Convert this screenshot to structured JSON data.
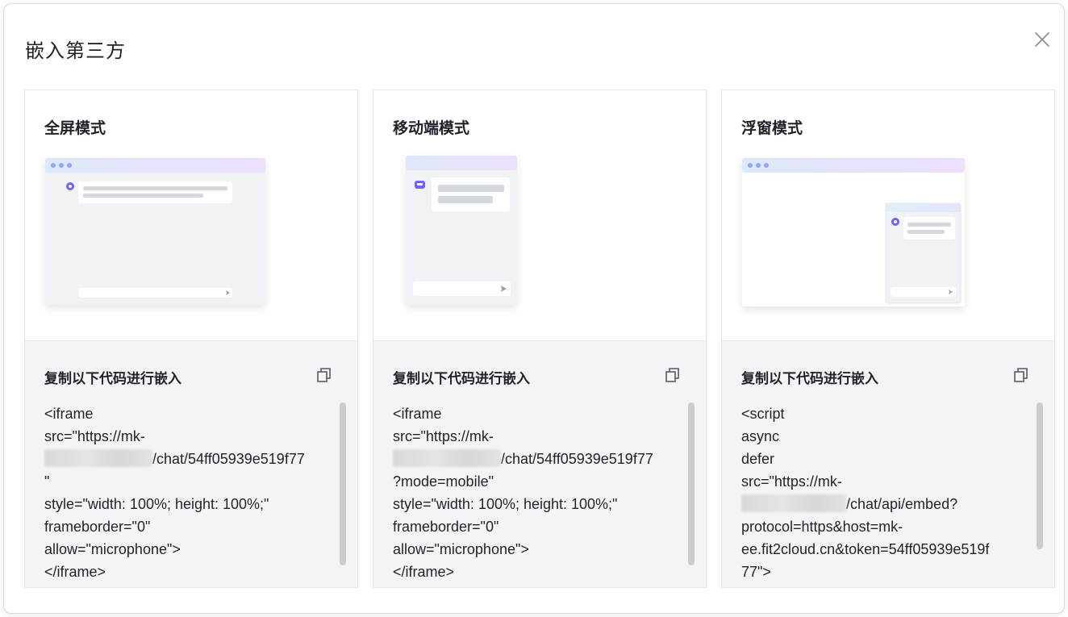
{
  "dialog": {
    "title": "嵌入第三方",
    "close_icon": "close-icon"
  },
  "cards": [
    {
      "title": "全屏模式",
      "code_label": "复制以下代码进行嵌入",
      "code_lines": [
        "<iframe",
        "src=\"https://mk-",
        "/chat/54ff05939e519f77",
        "\"",
        "style=\"width: 100%; height: 100%;\"",
        "frameborder=\"0\"",
        "allow=\"microphone\">",
        "</iframe>"
      ]
    },
    {
      "title": "移动端模式",
      "code_label": "复制以下代码进行嵌入",
      "code_lines": [
        "<iframe",
        "src=\"https://mk-",
        "/chat/54ff05939e519f77",
        "?mode=mobile\"",
        "style=\"width: 100%; height: 100%;\"",
        "frameborder=\"0\"",
        "allow=\"microphone\">",
        "</iframe>"
      ]
    },
    {
      "title": "浮窗模式",
      "code_label": "复制以下代码进行嵌入",
      "code_lines": [
        "<script",
        "async",
        "defer",
        "src=\"https://mk-",
        "/chat/api/embed?",
        "protocol=https&host=mk-",
        "ee.fit2cloud.cn&token=54ff05939e519f",
        "77\">"
      ]
    }
  ],
  "colors": {
    "accent": "#6c63ff",
    "preview_bg": "#f0f2f5",
    "header_gradient_start": "#dde8fb",
    "header_gradient_end": "#ede0fc"
  }
}
